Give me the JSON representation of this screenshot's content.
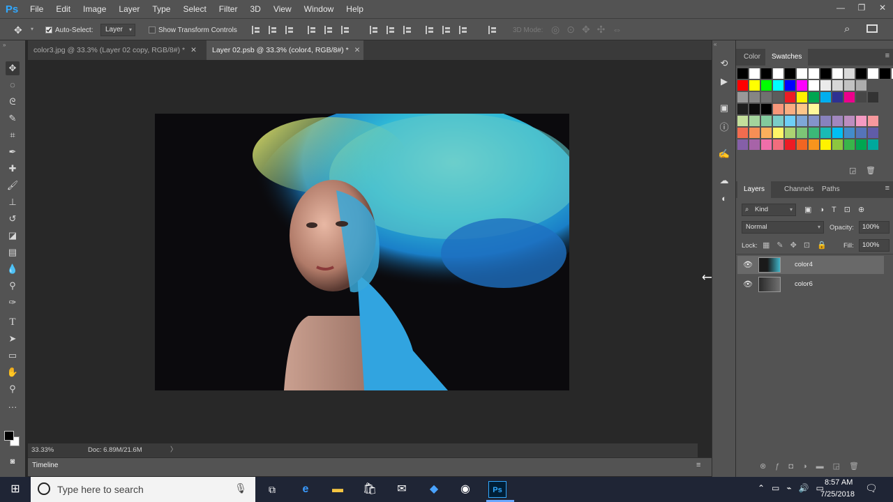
{
  "app": {
    "logo": "Ps"
  },
  "menubar": [
    "File",
    "Edit",
    "Image",
    "Layer",
    "Type",
    "Select",
    "Filter",
    "3D",
    "View",
    "Window",
    "Help"
  ],
  "window_controls": {
    "minimize": "—",
    "restore": "❐",
    "close": "✕"
  },
  "options": {
    "auto_select_label": "Auto-Select:",
    "auto_select_checked": true,
    "auto_select_target": "Layer",
    "show_transform_label": "Show Transform Controls",
    "mode_3d_label": "3D Mode:"
  },
  "tabs": [
    {
      "label": "color3.jpg @ 33.3% (Layer 02 copy, RGB/8#) *",
      "close": "✕"
    },
    {
      "label": "Layer 02.psb @ 33.3% (color4, RGB/8#) *",
      "close": "✕",
      "active": true
    }
  ],
  "status": {
    "zoom": "33.33%",
    "doc": "Doc: 6.89M/21.6M",
    "arrow": "〉"
  },
  "timeline": {
    "label": "Timeline"
  },
  "panels": {
    "color_tab": "Color",
    "swatches_tab": "Swatches",
    "layers_tab": "Layers",
    "channels_tab": "Channels",
    "paths_tab": "Paths",
    "kind_label": "Kind",
    "blend_mode": "Normal",
    "opacity_label": "Opacity:",
    "opacity_value": "100%",
    "lock_label": "Lock:",
    "fill_label": "Fill:",
    "fill_value": "100%"
  },
  "layers": [
    {
      "name": "color4",
      "selected": true
    },
    {
      "name": "color6",
      "selected": false
    }
  ],
  "swatch_colors": {
    "row1": [
      "#000000",
      "#ffffff",
      "#000000",
      "#ffffff",
      "#000000",
      "#ffffff",
      "#ffffff",
      "#000000",
      "#ffffff",
      "#d9d9d9",
      "#000000",
      "#ffffff",
      "#000000",
      "#ffffff"
    ],
    "row2": [
      "#ff0000",
      "#ffff00",
      "#00ff00",
      "#00ffff",
      "#0000ff",
      "#ff00ff",
      "#ffffff",
      "#ebebeb",
      "#d6d6d6",
      "#c2c2c2",
      "#adadad"
    ],
    "row3": [
      "#999999",
      "#858585",
      "#707070",
      "#5c5c5c",
      "#ed1c24",
      "#fff200",
      "#00a651",
      "#00aeef",
      "#2e3192",
      "#ec008c",
      "#474747",
      "#333333"
    ],
    "row4": [
      "#1f1f1f",
      "#0a0a0a",
      "#000000",
      "#f7977a",
      "#f9ad81",
      "#fdc68a",
      "#fff79a"
    ],
    "row5": [
      "#c4df9b",
      "#a3d39c",
      "#82ca9d",
      "#7bcdc8",
      "#6ecff6",
      "#7ea7d8",
      "#8493ca",
      "#8882be",
      "#a187be",
      "#bc8dbf",
      "#f49ac2",
      "#f6989d"
    ],
    "row6": [
      "#f26c4f",
      "#f68e55",
      "#fbaf5c",
      "#fff467",
      "#acd372",
      "#7cc576",
      "#3bb878",
      "#1abbb4",
      "#00bff3",
      "#438ccb",
      "#5574b9",
      "#605ca8"
    ],
    "row7": [
      "#855fa8",
      "#a763a8",
      "#f06ea9",
      "#f26d7d",
      "#ed1c24",
      "#f26522",
      "#f7941d",
      "#fff200",
      "#8dc63f",
      "#39b54a",
      "#00a651",
      "#00a99d"
    ]
  },
  "taskbar": {
    "search_placeholder": "Type here to search",
    "time": "8:57 AM",
    "date": "7/25/2018"
  }
}
